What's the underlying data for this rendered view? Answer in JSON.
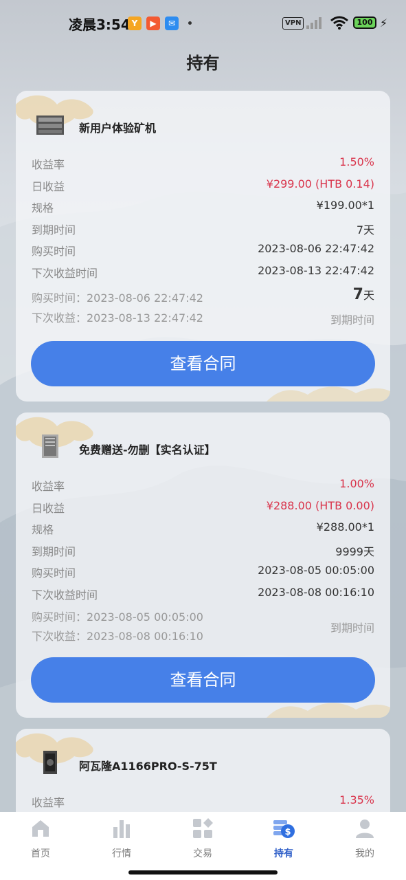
{
  "status": {
    "time": "凌晨3:54",
    "vpn": "VPN",
    "battery": "100",
    "app_badge_colors": [
      "#f5a623",
      "#f35a32",
      "#2d8cf0"
    ]
  },
  "page": {
    "title": "持有"
  },
  "cards": [
    {
      "name": "新用户体验矿机",
      "rows": [
        {
          "label": "收益率",
          "value": "1.50%"
        },
        {
          "label": "日收益",
          "value": "¥299.00 (HTB 0.14)"
        },
        {
          "label": "规格",
          "value": "¥199.00*1"
        },
        {
          "label": "到期时间",
          "value": "7天"
        },
        {
          "label": "购买时间",
          "value": "2023-08-06 22:47:42"
        },
        {
          "label": "下次收益时间",
          "value": "2023-08-13 22:47:42"
        }
      ],
      "purchase_line": "购买时间：2023-08-06 22:47:42",
      "next_line": "下次收益：2023-08-13 22:47:42",
      "days_number": "7",
      "days_unit": "天",
      "expire_label": "到期时间",
      "button": "查看合同"
    },
    {
      "name": "免费赠送-勿删【实名认证】",
      "rows": [
        {
          "label": "收益率",
          "value": "1.00%"
        },
        {
          "label": "日收益",
          "value": "¥288.00 (HTB 0.00)"
        },
        {
          "label": "规格",
          "value": "¥288.00*1"
        },
        {
          "label": "到期时间",
          "value": "9999天"
        },
        {
          "label": "购买时间",
          "value": "2023-08-05 00:05:00"
        },
        {
          "label": "下次收益时间",
          "value": "2023-08-08 00:16:10"
        }
      ],
      "purchase_line": "购买时间：2023-08-05 00:05:00",
      "next_line": "下次收益：2023-08-08 00:16:10",
      "expire_label": "到期时间",
      "button": "查看合同"
    },
    {
      "name": "阿瓦隆A1166PRO-S-75T",
      "rows": [
        {
          "label": "收益率",
          "value": "1.35%"
        }
      ]
    }
  ],
  "tabs": [
    {
      "label": "首页",
      "icon": "home-icon"
    },
    {
      "label": "行情",
      "icon": "chart-bars-icon"
    },
    {
      "label": "交易",
      "icon": "grid-icon"
    },
    {
      "label": "持有",
      "icon": "holdings-coin-icon",
      "active": true
    },
    {
      "label": "我的",
      "icon": "user-icon"
    }
  ],
  "colors": {
    "accent": "#4680e8",
    "highlight": "#d9344b",
    "tab_active": "#2f5fc8"
  }
}
